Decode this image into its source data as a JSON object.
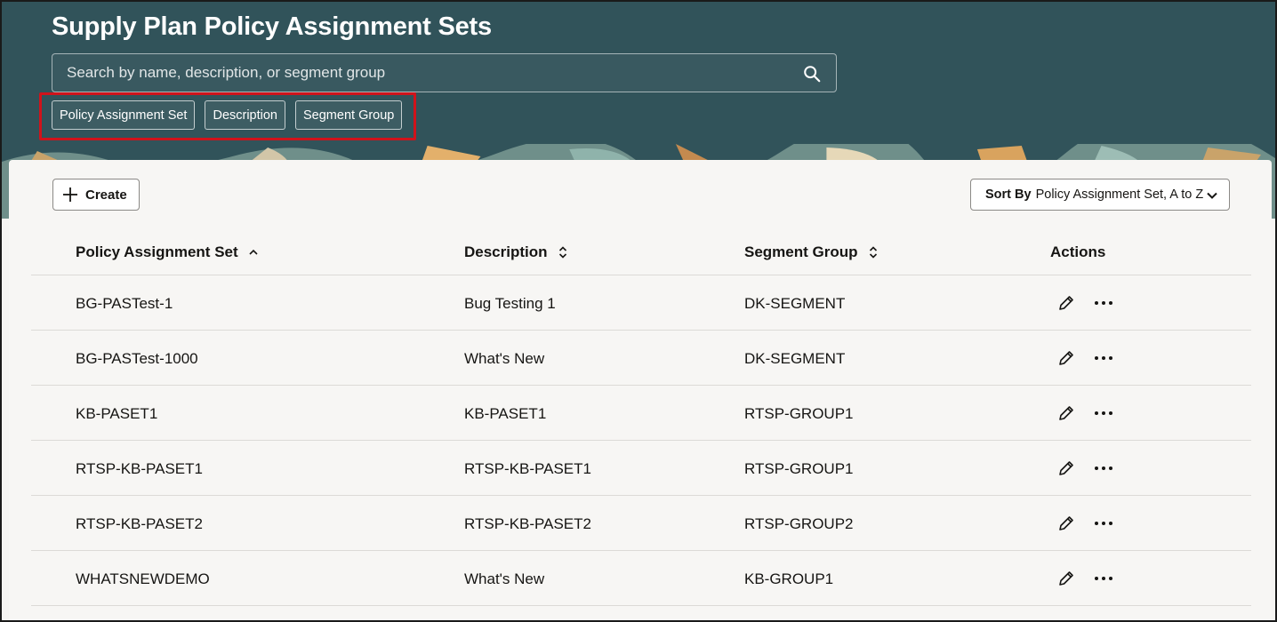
{
  "app": {
    "title": "Supply Plan Policy Assignment Sets"
  },
  "search": {
    "placeholder": "Search by name, description, or segment group",
    "value": ""
  },
  "filter_chips": [
    {
      "label": "Policy Assignment Set"
    },
    {
      "label": "Description"
    },
    {
      "label": "Segment Group"
    }
  ],
  "toolbar": {
    "create_label": "Create",
    "sort_prefix": "Sort By",
    "sort_value": "Policy Assignment Set, A to Z"
  },
  "table": {
    "columns": [
      {
        "label": "Policy Assignment Set",
        "sort": "ascending"
      },
      {
        "label": "Description",
        "sort": "sortable"
      },
      {
        "label": "Segment Group",
        "sort": "sortable"
      },
      {
        "label": "Actions",
        "sort": "none"
      }
    ],
    "rows": [
      {
        "set": "BG-PASTest-1",
        "description": "Bug Testing 1",
        "segment_group": "DK-SEGMENT"
      },
      {
        "set": "BG-PASTest-1000",
        "description": "What's New",
        "segment_group": "DK-SEGMENT"
      },
      {
        "set": "KB-PASET1",
        "description": "KB-PASET1",
        "segment_group": "RTSP-GROUP1"
      },
      {
        "set": "RTSP-KB-PASET1",
        "description": "RTSP-KB-PASET1",
        "segment_group": "RTSP-GROUP1"
      },
      {
        "set": "RTSP-KB-PASET2",
        "description": "RTSP-KB-PASET2",
        "segment_group": "RTSP-GROUP2"
      },
      {
        "set": "WHATSNEWDEMO",
        "description": "What's New",
        "segment_group": "KB-GROUP1"
      }
    ],
    "row_actions": [
      "edit-icon",
      "more-options-icon"
    ]
  },
  "colors": {
    "header_bg": "#31535a",
    "highlight_border": "#d0131b",
    "panel_bg": "#f7f6f4"
  }
}
